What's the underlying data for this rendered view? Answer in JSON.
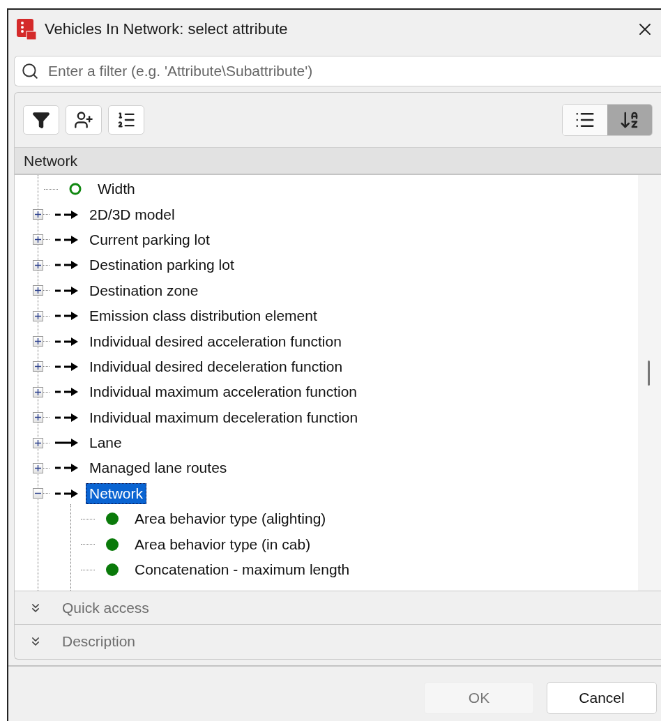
{
  "window": {
    "title": "Vehicles In Network: select attribute"
  },
  "filter": {
    "placeholder": "Enter a filter (e.g. 'Attribute\\Subattribute')"
  },
  "toolbar": {
    "view_buttons": [
      {
        "kind": "list",
        "selected": false
      },
      {
        "kind": "sort",
        "selected": true
      }
    ]
  },
  "tree": {
    "header": "Network",
    "items": [
      {
        "label": "Width",
        "kind": "attribute-empty",
        "selected": false
      },
      {
        "label": "2D/3D model",
        "kind": "relation",
        "expanded": false,
        "selected": false
      },
      {
        "label": "Current parking lot",
        "kind": "relation",
        "expanded": false,
        "selected": false
      },
      {
        "label": "Destination parking lot",
        "kind": "relation",
        "expanded": false,
        "selected": false
      },
      {
        "label": "Destination zone",
        "kind": "relation",
        "expanded": false,
        "selected": false
      },
      {
        "label": "Emission class distribution element",
        "kind": "relation",
        "expanded": false,
        "selected": false
      },
      {
        "label": "Individual desired acceleration function",
        "kind": "relation",
        "expanded": false,
        "selected": false
      },
      {
        "label": "Individual desired deceleration function",
        "kind": "relation",
        "expanded": false,
        "selected": false
      },
      {
        "label": "Individual maximum acceleration function",
        "kind": "relation",
        "expanded": false,
        "selected": false
      },
      {
        "label": "Individual maximum deceleration function",
        "kind": "relation",
        "expanded": false,
        "selected": false
      },
      {
        "label": "Lane",
        "kind": "relation-single",
        "expanded": false,
        "selected": false
      },
      {
        "label": "Managed lane routes",
        "kind": "relation",
        "expanded": false,
        "selected": false
      },
      {
        "label": "Network",
        "kind": "relation",
        "expanded": true,
        "selected": true,
        "children": [
          {
            "label": "Area behavior type (alighting)",
            "kind": "attribute",
            "selected": false
          },
          {
            "label": "Area behavior type (in cab)",
            "kind": "attribute",
            "selected": false
          },
          {
            "label": "Concatenation - maximum length",
            "kind": "attribute",
            "selected": false
          }
        ]
      }
    ]
  },
  "sections": [
    {
      "label": "Quick access",
      "expanded": false
    },
    {
      "label": "Description",
      "expanded": false
    }
  ],
  "buttons": [
    {
      "label": "OK",
      "disabled": true
    },
    {
      "label": "Cancel",
      "disabled": false
    }
  ]
}
